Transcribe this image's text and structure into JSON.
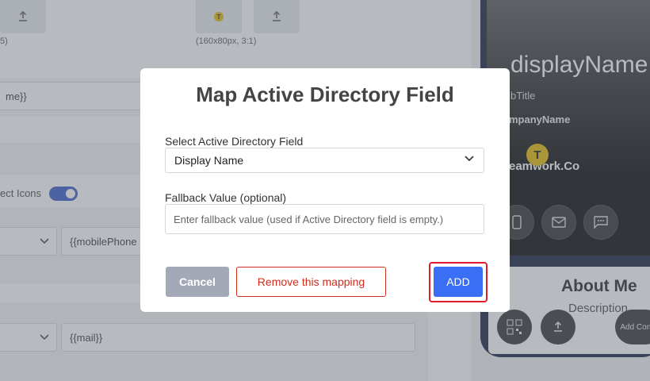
{
  "background": {
    "upload_hint_left": "5)",
    "logo_size_hint": "(160x80px, 3:1)",
    "logo_letter": "T",
    "name_field_value": "me}}",
    "icons_label": "ect Icons",
    "mobile_field_value": "{{mobilePhone",
    "mail_field_value": "{{mail}}"
  },
  "preview": {
    "display_name": "displayName",
    "job_title": "bTitle",
    "company_name": "mpanyName",
    "logo_letter": "T",
    "brand_text": "eamwork.Co",
    "about_title": "About Me",
    "about_subtitle": "Description",
    "add_contact_label": "Add Conta"
  },
  "modal": {
    "title": "Map Active Directory Field",
    "select_label": "Select Active Directory Field",
    "select_value": "Display Name",
    "fallback_label": "Fallback Value (optional)",
    "fallback_placeholder": "Enter fallback value (used if Active Directory field is empty.)",
    "cancel_label": "Cancel",
    "remove_label": "Remove this mapping",
    "add_label": "ADD"
  },
  "colors": {
    "accent": "#3a6ff5",
    "danger": "#d02f1d",
    "highlight": "#e11a2b",
    "cancel_bg": "#a3a9b7"
  }
}
